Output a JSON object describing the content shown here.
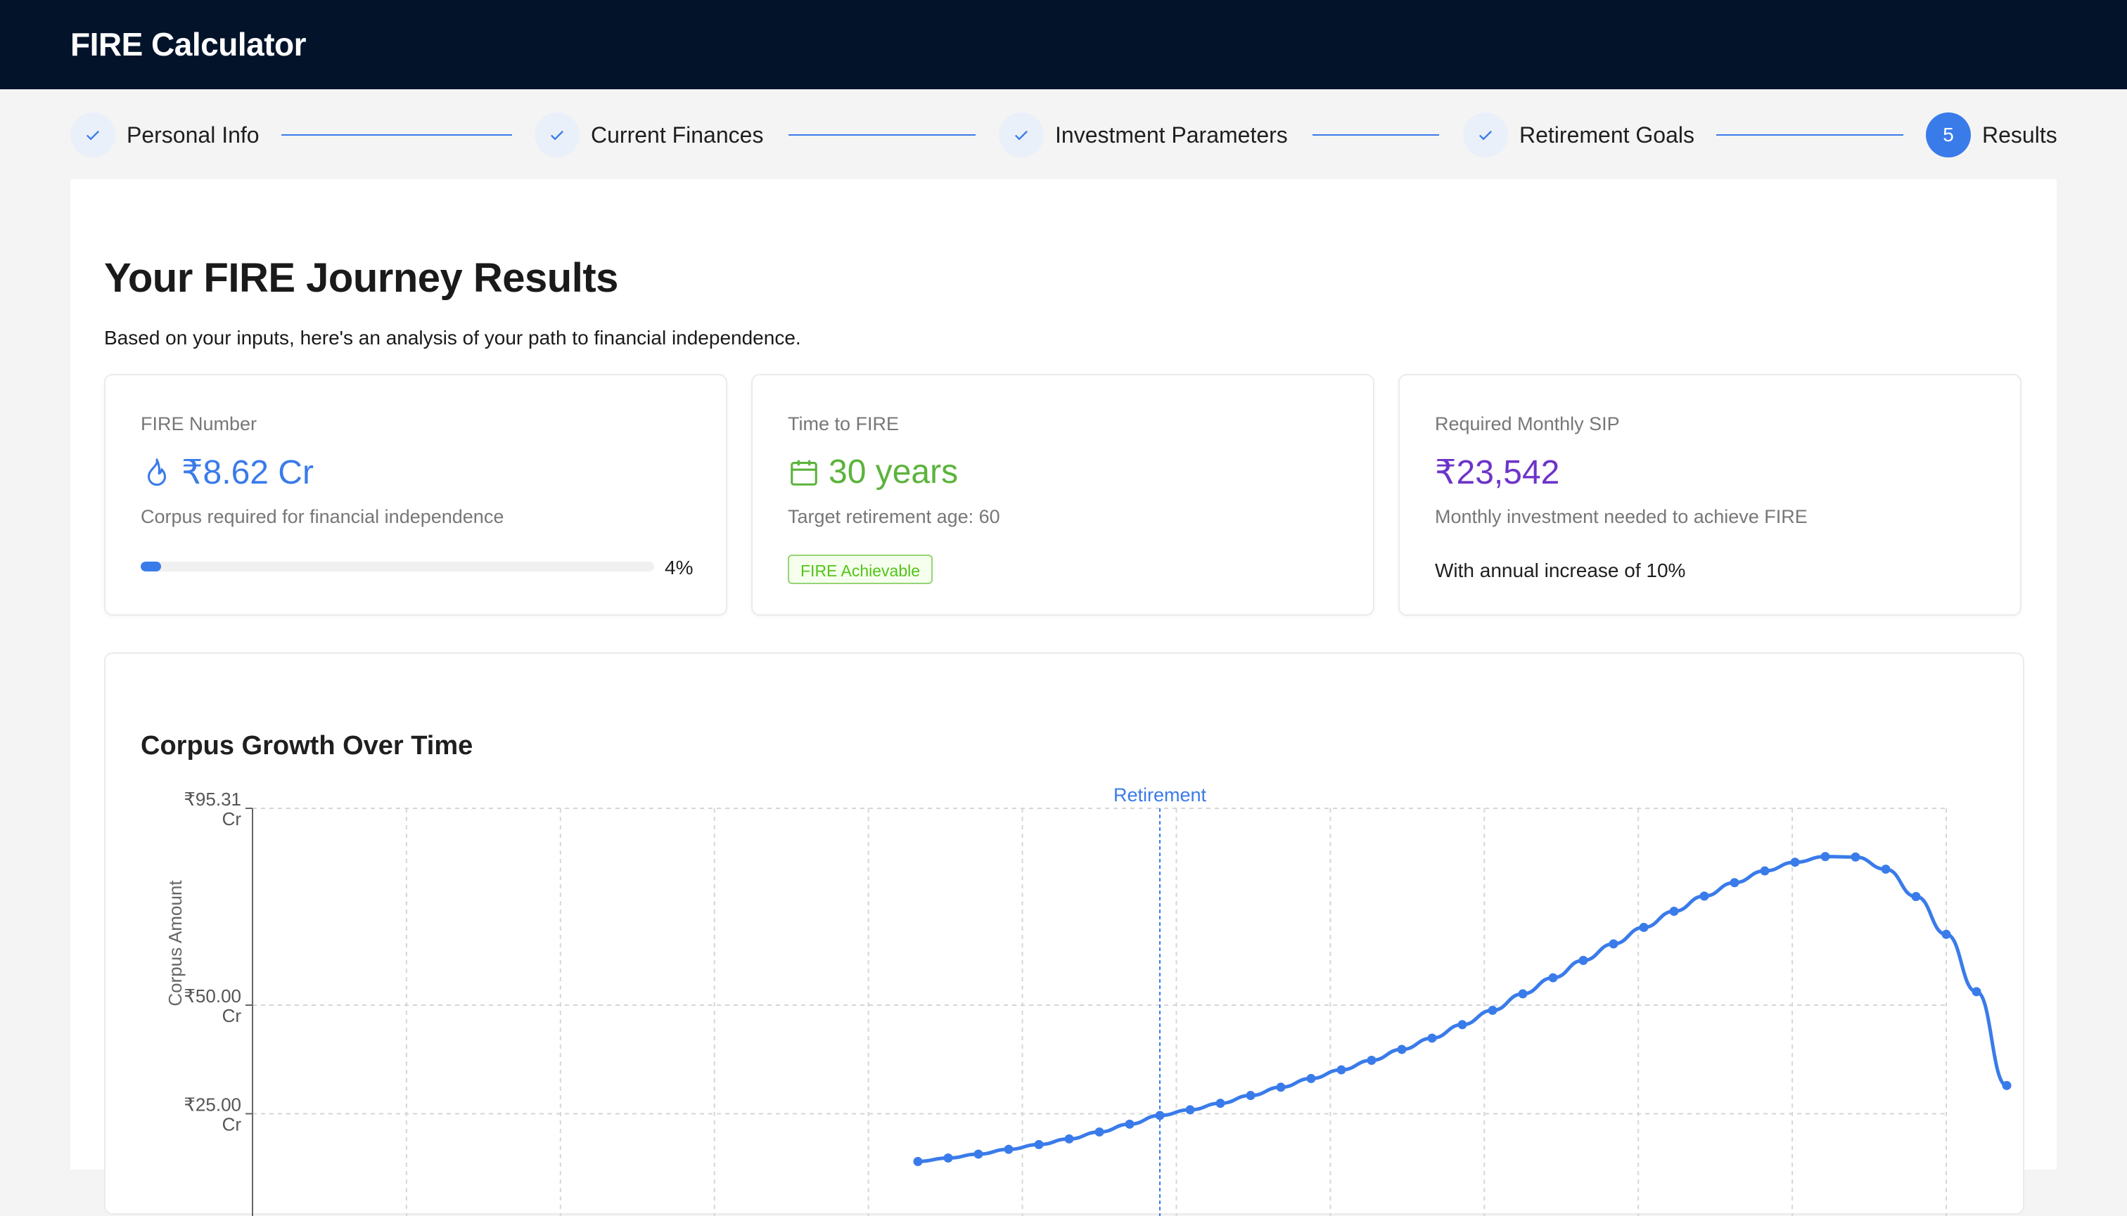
{
  "app": {
    "title": "FIRE Calculator"
  },
  "stepper": {
    "steps": [
      {
        "label": "Personal Info",
        "status": "complete",
        "icon": "check-icon"
      },
      {
        "label": "Current Finances",
        "status": "complete",
        "icon": "check-icon"
      },
      {
        "label": "Investment Parameters",
        "status": "complete",
        "icon": "check-icon"
      },
      {
        "label": "Retirement Goals",
        "status": "complete",
        "icon": "check-icon"
      },
      {
        "label": "Results",
        "status": "active",
        "number": "5"
      }
    ],
    "accent_color": "#3a7bea"
  },
  "results": {
    "title": "Your FIRE Journey Results",
    "subtitle": "Based on your inputs, here's an analysis of your path to financial independence.",
    "cards": {
      "fire_number": {
        "label": "FIRE Number",
        "value": "₹8.62 Cr",
        "icon": "flame-icon",
        "description": "Corpus required for financial independence",
        "progress_text": "4%",
        "progress_fraction": 0.04,
        "color": "#3a7bea"
      },
      "time_to_fire": {
        "label": "Time to FIRE",
        "value": "30 years",
        "icon": "calendar-icon",
        "description": "Target retirement age: 60",
        "badge": "FIRE Achievable",
        "color": "#5bb33c"
      },
      "monthly_sip": {
        "label": "Required Monthly SIP",
        "value": "₹23,542",
        "description": "Monthly investment needed to achieve FIRE",
        "note": "With annual increase of 10%",
        "color": "#6d34c8"
      }
    }
  },
  "chart_data": {
    "type": "line",
    "title": "Corpus Growth Over Time",
    "ylabel": "Corpus Amount",
    "y_ticks": [
      "₹95.31 Cr",
      "₹50.00 Cr",
      "₹25.00 Cr"
    ],
    "y_tick_values": [
      95.31,
      50,
      25
    ],
    "y_range_visible": [
      14.0,
      95.31
    ],
    "annotation": {
      "label": "Retirement",
      "x_index": 30
    },
    "grid": true,
    "line_color": "#3a7bea",
    "series": [
      {
        "x_index": [
          22,
          23,
          24,
          25,
          26,
          27,
          28,
          29,
          30,
          31,
          32,
          33,
          34,
          35,
          36,
          37,
          38,
          39,
          40,
          41,
          42,
          43,
          44,
          45,
          46,
          47,
          48,
          49,
          50,
          51,
          52,
          53,
          54,
          55,
          56,
          57,
          58
        ],
        "values": [
          14.0,
          14.8,
          15.7,
          16.8,
          17.9,
          19.2,
          20.8,
          22.6,
          24.6,
          25.9,
          27.4,
          29.2,
          31.1,
          33.1,
          35.1,
          37.3,
          39.8,
          42.4,
          45.5,
          48.8,
          52.6,
          56.3,
          60.3,
          64.1,
          67.9,
          71.6,
          75.1,
          78.2,
          80.9,
          82.9,
          84.2,
          84.1,
          81.3,
          75.0,
          66.3,
          53.1,
          31.5
        ]
      }
    ]
  }
}
